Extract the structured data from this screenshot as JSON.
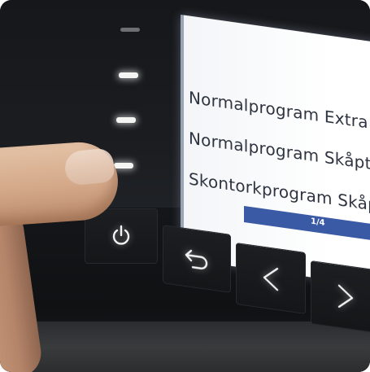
{
  "display": {
    "menu_items": [
      "Normalprogram Extra to",
      "Normalprogram Skåptorr",
      "Skontorkprogram Skåptor"
    ],
    "page_indicator": "1/4"
  },
  "indicator_leds": [
    {
      "state": "dim"
    },
    {
      "state": "lit"
    },
    {
      "state": "lit"
    },
    {
      "state": "lit"
    }
  ],
  "buttons": {
    "power": {
      "icon": "power-icon"
    },
    "back": {
      "icon": "back-arrow-icon"
    },
    "previous": {
      "icon": "chevron-left-icon"
    },
    "next": {
      "icon": "chevron-right-icon"
    }
  },
  "colors": {
    "screen_background": "#ffffff",
    "menu_text": "#2e3440",
    "page_bar": "#3b5aa6",
    "led_lit": "#f4f4f2",
    "panel": "#15171a"
  }
}
